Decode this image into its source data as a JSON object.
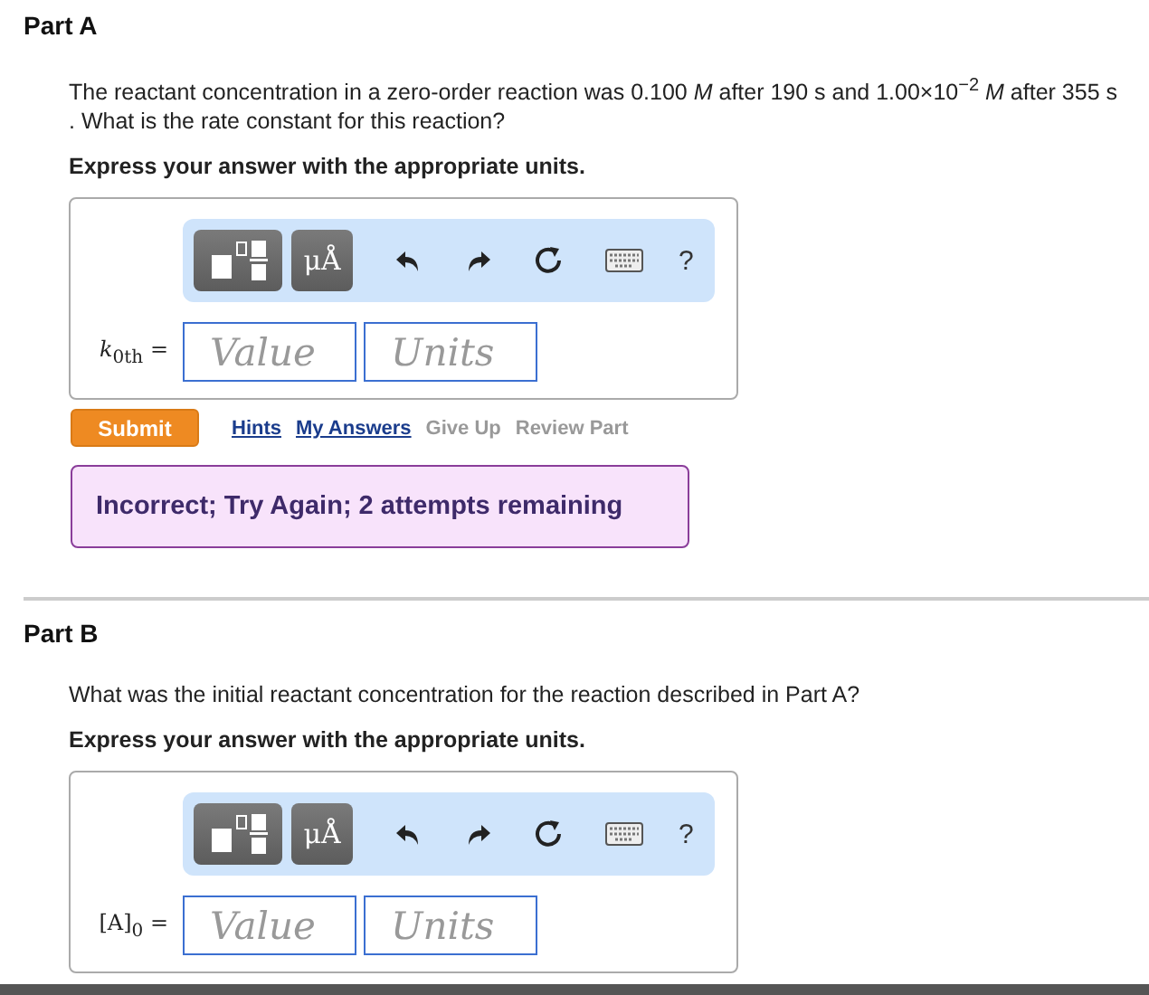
{
  "parts": [
    {
      "title": "Part A",
      "question": "The reactant concentration in a zero-order reaction was 0.100 *M* after 190 s and 1.00×10$^{−2}$ *M* after 355 s . What is the rate constant for this reaction?",
      "instruction": "Express your answer with the appropriate units.",
      "toolbar": {
        "units_button": "μÅ",
        "help": "?"
      },
      "answer": {
        "label": "*k*$_{0th}$ =",
        "fields": [
          {
            "placeholder": "Value"
          },
          {
            "placeholder": "Units"
          }
        ]
      },
      "actions": {
        "submit": "Submit",
        "links": [
          {
            "label": "Hints",
            "disabled": false
          },
          {
            "label": "My Answers",
            "disabled": false
          },
          {
            "label": "Give Up",
            "disabled": true
          },
          {
            "label": "Review Part",
            "disabled": true
          }
        ]
      },
      "feedback": "Incorrect; Try Again; 2 attempts remaining"
    },
    {
      "title": "Part B",
      "question": "What was the initial reactant concentration for the reaction described in Part A?",
      "instruction": "Express your answer with the appropriate units.",
      "toolbar": {
        "units_button": "μÅ",
        "help": "?"
      },
      "answer": {
        "label": "[A]$_{0}$ =",
        "fields": [
          {
            "placeholder": "Value"
          },
          {
            "placeholder": "Units"
          }
        ]
      }
    }
  ]
}
